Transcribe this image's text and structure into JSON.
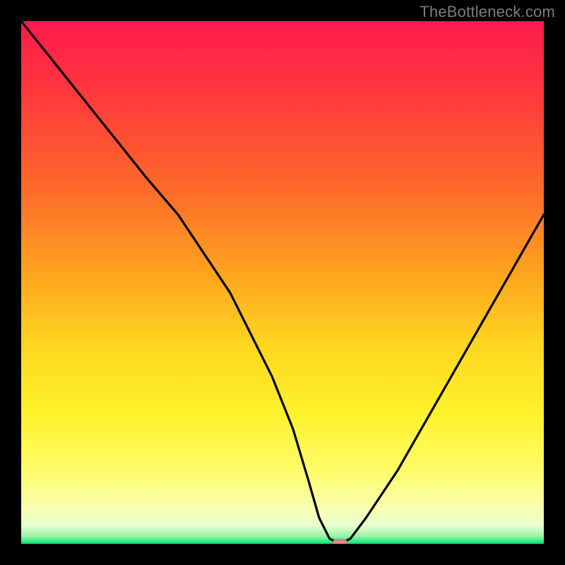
{
  "attribution": "TheBottleneck.com",
  "colors": {
    "frame": "#000000",
    "gradient_stops": [
      {
        "offset": 0.0,
        "color": "#ff1a4d"
      },
      {
        "offset": 0.15,
        "color": "#ff3b3b"
      },
      {
        "offset": 0.32,
        "color": "#ff6a2a"
      },
      {
        "offset": 0.48,
        "color": "#ffa31f"
      },
      {
        "offset": 0.62,
        "color": "#ffd61f"
      },
      {
        "offset": 0.75,
        "color": "#fff22b"
      },
      {
        "offset": 0.86,
        "color": "#fffc6a"
      },
      {
        "offset": 0.93,
        "color": "#f8ffb0"
      },
      {
        "offset": 0.965,
        "color": "#e8ffcf"
      },
      {
        "offset": 0.985,
        "color": "#9cf5a8"
      },
      {
        "offset": 1.0,
        "color": "#00e57a"
      }
    ],
    "curve": "#000000",
    "marker_fill": "#d98d86",
    "marker_stroke": "#b86f68"
  },
  "chart_data": {
    "type": "line",
    "title": "",
    "xlabel": "",
    "ylabel": "",
    "xlim": [
      0,
      100
    ],
    "ylim": [
      0,
      100
    ],
    "series": [
      {
        "name": "bottleneck-curve",
        "x": [
          0,
          8,
          16,
          24,
          30,
          40,
          48,
          52,
          55,
          57,
          59,
          61,
          63,
          66,
          72,
          80,
          88,
          96,
          100
        ],
        "y": [
          100,
          90,
          80,
          70,
          63,
          48,
          32,
          22,
          12,
          5,
          1,
          0,
          1,
          5,
          14,
          28,
          42,
          56,
          63
        ]
      }
    ],
    "marker": {
      "x": 61,
      "y": 0
    }
  }
}
